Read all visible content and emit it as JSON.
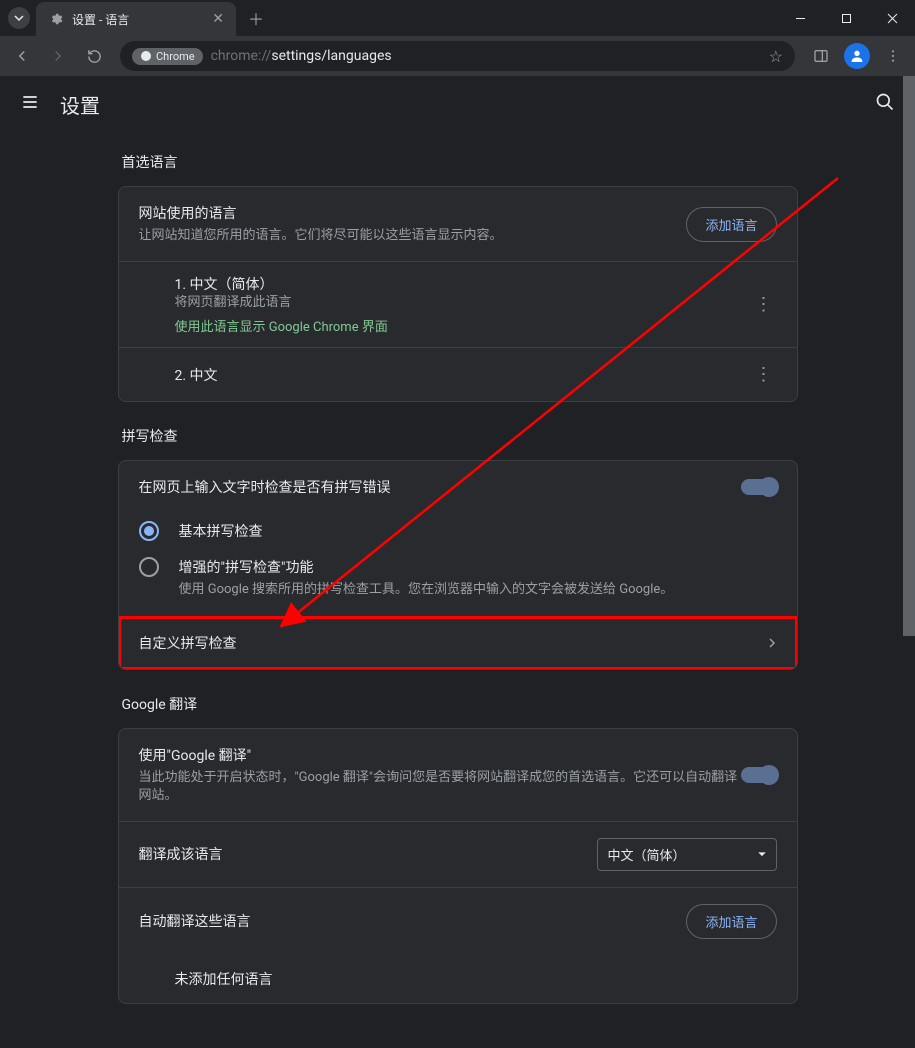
{
  "window": {
    "tab_title": "设置 - 语言"
  },
  "address": {
    "chip": "Chrome",
    "url_prefix": "chrome://",
    "url_path": "settings/languages"
  },
  "header": {
    "title": "设置"
  },
  "preferred": {
    "section": "首选语言",
    "header_title": "网站使用的语言",
    "header_desc": "让网站知道您所用的语言。它们将尽可能以这些语言显示内容。",
    "add_btn": "添加语言",
    "langs": [
      {
        "name": "1. 中文（简体）",
        "desc": "将网页翻译成此语言",
        "green": "使用此语言显示 Google Chrome 界面"
      },
      {
        "name": "2. 中文"
      }
    ]
  },
  "spell": {
    "section": "拼写检查",
    "toggle_label": "在网页上输入文字时检查是否有拼写错误",
    "basic_label": "基本拼写检查",
    "enhanced_label": "增强的\"拼写检查\"功能",
    "enhanced_desc": "使用 Google 搜索所用的拼写检查工具。您在浏览器中输入的文字会被发送给 Google。",
    "custom": "自定义拼写检查"
  },
  "translate": {
    "section": "Google 翻译",
    "use_title": "使用\"Google 翻译\"",
    "use_desc": "当此功能处于开启状态时，\"Google 翻译\"会询问您是否要将网站翻译成您的首选语言。它还可以自动翻译网站。",
    "target_label": "翻译成该语言",
    "target_value": "中文（简体）",
    "auto_label": "自动翻译这些语言",
    "add_btn": "添加语言",
    "empty": "未添加任何语言"
  }
}
